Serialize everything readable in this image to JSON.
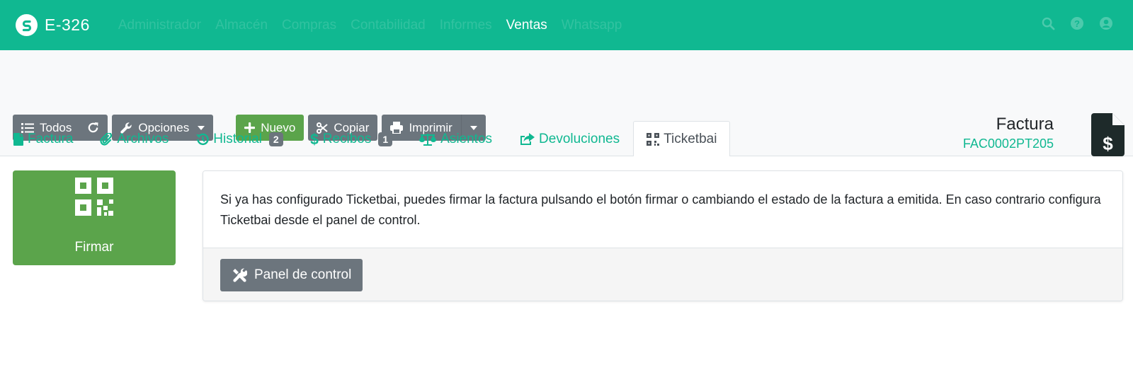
{
  "app": {
    "name": "E-326",
    "logo_icon": "facturascripts-logo"
  },
  "nav": {
    "items": [
      "Administrador",
      "Almacén",
      "Compras",
      "Contabilidad",
      "Informes",
      "Ventas",
      "Whatsapp"
    ],
    "active": "Ventas",
    "right_icons": [
      "search-icon",
      "help-icon",
      "user-icon"
    ]
  },
  "toolbar": {
    "todos_label": "Todos",
    "opciones_label": "Opciones",
    "nuevo_label": "Nuevo",
    "copiar_label": "Copiar",
    "imprimir_label": "Imprimir"
  },
  "document": {
    "type": "Factura",
    "code": "FAC0002PT205"
  },
  "tabs": [
    {
      "label": "Factura",
      "icon": "file-icon"
    },
    {
      "label": "Archivos",
      "icon": "paperclip-icon"
    },
    {
      "label": "Historial",
      "icon": "history-icon",
      "badge": "2"
    },
    {
      "label": "Recibos",
      "icon": "dollar-icon",
      "badge": "1"
    },
    {
      "label": "Asientos",
      "icon": "balance-scale-icon"
    },
    {
      "label": "Devoluciones",
      "icon": "share-icon"
    },
    {
      "label": "Ticketbai",
      "icon": "qrcode-icon",
      "active": true
    }
  ],
  "sign_card": {
    "label": "Firmar",
    "icon": "qrcode-icon"
  },
  "info_panel": {
    "text": "Si ya has configurado Ticketbai, puedes firmar la factura pulsando el botón firmar o cambiando el estado de la factura a emitida. En caso contrario configura Ticketbai desde el panel de control.",
    "button_label": "Panel de control"
  },
  "colors": {
    "brand": "#10b891",
    "success": "#5ba44b",
    "secondary": "#6c757d"
  }
}
